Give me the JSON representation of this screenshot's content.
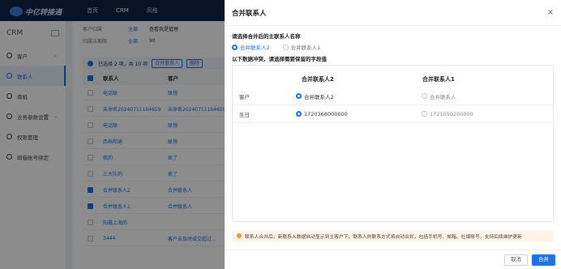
{
  "app": {
    "logo_text": "中亿转接通",
    "nav": [
      "首页",
      "CRM",
      "风格"
    ]
  },
  "sidebar": {
    "title": "CRM",
    "items": [
      {
        "label": "客户",
        "caret": "⌄"
      },
      {
        "label": "联系人",
        "caret": ""
      },
      {
        "label": "商机",
        "caret": ""
      },
      {
        "label": "业务参数设置",
        "caret": "⌄"
      },
      {
        "label": "权限管理",
        "caret": ""
      },
      {
        "label": "邮箱账号绑定",
        "caret": ""
      }
    ]
  },
  "main": {
    "filter_rows": [
      {
        "label": "客户归属",
        "chips": [
          "全部",
          "查看我是管理"
        ]
      },
      {
        "label": "归属法期限",
        "chips": [
          "全部",
          "90"
        ]
      }
    ],
    "notice": {
      "text": "已选择 2 项，共 10 项",
      "btn_merge": "合并联系人",
      "btn_delete": "删除"
    },
    "table": {
      "headers": [
        "联系人",
        "客户"
      ],
      "rows": [
        {
          "name": "电话联",
          "customer": "联想",
          "checked": false
        },
        {
          "name": "未命名20240711164659",
          "customer": "未命名20240711164659",
          "checked": false
        },
        {
          "name": "电话联",
          "customer": "联想",
          "checked": false
        },
        {
          "name": "西档和迪",
          "customer": "联想",
          "checked": false
        },
        {
          "name": "我的",
          "customer": "疯了",
          "checked": false
        },
        {
          "name": "三大队的",
          "customer": "疯了",
          "checked": false
        },
        {
          "name": "合并联系人2",
          "customer": "合并联系人",
          "checked": true
        },
        {
          "name": "合并联系人1",
          "customer": "合并联系人",
          "checked": true
        },
        {
          "name": "阳晨上海的",
          "customer": "",
          "checked": false
        },
        {
          "name": "3444",
          "customer": "客户未及时成交超过...",
          "checked": false
        }
      ]
    }
  },
  "drawer": {
    "title": "合并联系人",
    "close_icon": "×",
    "select_label": "请选择合并后的主联系人名称",
    "radio_options": [
      {
        "label": "合并联系人2",
        "selected": true
      },
      {
        "label": "合并联系人1",
        "selected": false
      }
    ],
    "conflict_label": "以下数据冲突，请选择需要保留的字段值",
    "compare": {
      "col_a": "合并联系人2",
      "col_b": "合并联系人1",
      "rows": [
        {
          "label": "客户",
          "a": "合并联系人2",
          "b": "合并联系人",
          "a_selected": true
        },
        {
          "label": "生日",
          "a": "1720368000000",
          "b": "1721059200000",
          "a_selected": true
        }
      ]
    },
    "warning": "联系人合并后，新联系人数据自动显示到主客户下，联系人的联系方式将自动合并，包括手机号、邮箱、社媒账号，支持后续维护更新",
    "cancel_label": "取消",
    "confirm_label": "合并",
    "colors": {
      "primary": "#1a73e8",
      "warning": "#f59a23"
    }
  }
}
